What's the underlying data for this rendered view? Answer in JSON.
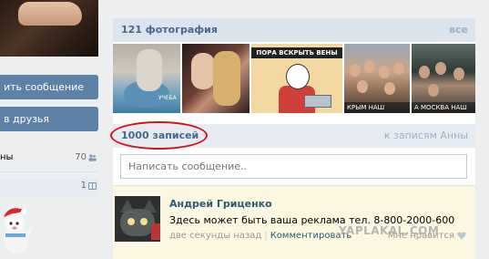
{
  "left": {
    "message_button": "ить сообщение",
    "friends_button": "в друзья",
    "row1": {
      "label": "ны",
      "count": "70"
    },
    "row2": {
      "count": "1"
    }
  },
  "photos": {
    "title": "121 фотография",
    "all_link": "все",
    "items": [
      {
        "caption": "УЧЕБА"
      },
      {
        "caption": ""
      },
      {
        "caption": "ПОРА ВСКРЫТЬ ВЕНЫ"
      },
      {
        "caption": "КРЫМ НАШ"
      },
      {
        "caption": "А МОСКВА НАШ"
      }
    ]
  },
  "wall": {
    "count": "1000 записей",
    "link": "к записям Анны",
    "input_placeholder": "Написать сообщение.."
  },
  "post": {
    "author": "Андрей Гриценко",
    "text": "Здесь может быть ваша реклама тел. 8-800-2000-600",
    "time": "две секунды назад",
    "comment": "Комментировать",
    "like": "Мне нравится"
  },
  "watermark": "YAPLAKAL.COM",
  "colors": {
    "accent": "#45688e",
    "button": "#5e81a8",
    "highlight": "#d4121b",
    "post_bg": "#fbf7e1"
  }
}
